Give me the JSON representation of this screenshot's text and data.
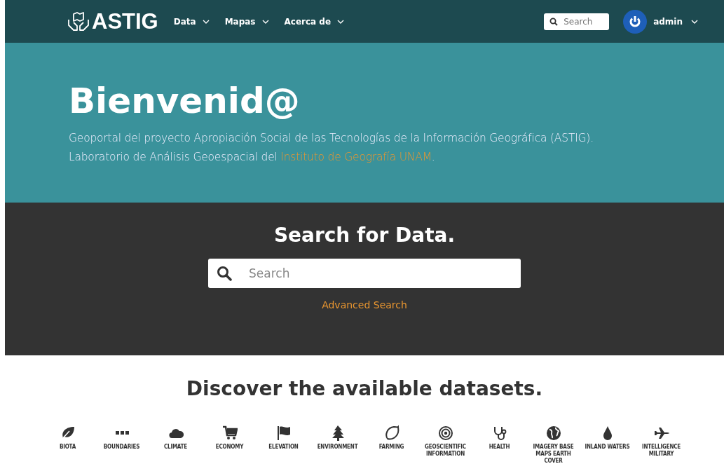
{
  "header": {
    "logo": "ASTIG",
    "nav": [
      {
        "label": "Data"
      },
      {
        "label": "Mapas"
      },
      {
        "label": "Acerca de"
      }
    ],
    "search": {
      "placeholder": "Search"
    },
    "user": "admin"
  },
  "hero": {
    "title": "Bienvenid@",
    "lines": [
      "Geoportal del proyecto Apropiación Social de las Tecnologías de la Información Geográfica (ASTIG).",
      "Laboratorio de Análisis Geoespacial del "
    ],
    "link": "Instituto de Geografía UNAM",
    "after_link": "."
  },
  "search_section": {
    "title": "Search for Data.",
    "placeholder": "Search",
    "advanced": "Advanced Search"
  },
  "datasets": {
    "title": "Discover the available datasets.",
    "categories": [
      {
        "label": "BIOTA"
      },
      {
        "label": "BOUNDARIES"
      },
      {
        "label": "CLIMATE"
      },
      {
        "label": "ECONOMY"
      },
      {
        "label": "ELEVATION"
      },
      {
        "label": "ENVIRONMENT"
      },
      {
        "label": "FARMING"
      },
      {
        "label": "GEOSCIENTIFIC INFORMATION"
      },
      {
        "label": "HEALTH"
      },
      {
        "label": "IMAGERY BASE MAPS EARTH COVER"
      },
      {
        "label": "INLAND WATERS"
      },
      {
        "label": "INTELLIGENCE MILITARY"
      }
    ]
  }
}
